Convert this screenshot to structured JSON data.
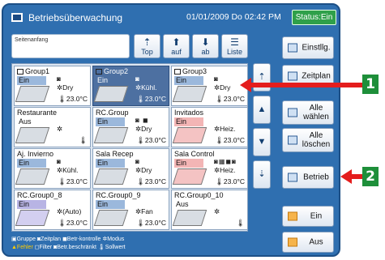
{
  "header": {
    "title": "Betriebsüberwachung",
    "datetime": "01/01/2009 Do 02:42 PM",
    "status": "Status:Ein"
  },
  "search": {
    "value": "Seitenanfang"
  },
  "nav": [
    {
      "symbol": "⇡",
      "label": "Top"
    },
    {
      "symbol": "⬆",
      "label": "auf"
    },
    {
      "symbol": "⬇",
      "label": "ab"
    },
    {
      "symbol": "☰",
      "label": "Liste"
    }
  ],
  "cells": [
    {
      "name": "Group1",
      "state": "Ein",
      "mode": "Dry",
      "temp": "23.0°C",
      "icons": "◙",
      "style": "on",
      "group_icon": true
    },
    {
      "name": "Group2",
      "state": "Ein",
      "mode": "Kühl.",
      "temp": "23.0°C",
      "icons": "◙",
      "style": "on",
      "group_icon": true,
      "selected": true
    },
    {
      "name": "Group3",
      "state": "Ein",
      "mode": "Dry",
      "temp": "23.0°C",
      "icons": "◙",
      "style": "on",
      "group_icon": true
    },
    {
      "name": "Restaurante",
      "state": "Aus",
      "mode": "",
      "temp": "",
      "icons": "",
      "style": "off"
    },
    {
      "name": "RC.Group",
      "state": "Ein",
      "mode": "Dry",
      "temp": "23.0°C",
      "icons": "◙  ◼",
      "style": "on"
    },
    {
      "name": "Invitados",
      "state": "Ein",
      "mode": "Heiz.",
      "temp": "23.0°C",
      "icons": "",
      "style": "heat"
    },
    {
      "name": "Aj. Invierno",
      "state": "Ein",
      "mode": "Kühl.",
      "temp": "23.0°C",
      "icons": "◙",
      "style": "on"
    },
    {
      "name": "Sala Recep",
      "state": "Ein",
      "mode": "Dry",
      "temp": "23.0°C",
      "icons": "◙",
      "style": "on"
    },
    {
      "name": "Sala Control",
      "state": "Ein",
      "mode": "Heiz.",
      "temp": "23.0°C",
      "icons": "◙▦◼◙",
      "style": "heat"
    },
    {
      "name": "RC.Group0_8",
      "state": "Ein",
      "mode": "(Auto)",
      "temp": "23.0°C",
      "icons": "",
      "style": "purple"
    },
    {
      "name": "RC.Group0_9",
      "state": "Ein",
      "mode": "Fan",
      "temp": "23.0°C",
      "icons": "",
      "style": "on"
    },
    {
      "name": "RC.Group0_10",
      "state": "Aus",
      "mode": "",
      "temp": "",
      "icons": "",
      "style": "off"
    }
  ],
  "legend": {
    "row1": "▣Gruppe ◙Zeitplan ◼Betr-kontrolle ✲Modus",
    "row2_a": "▲Fehler",
    "row2_b": " ◻Filter  ◙Betr.beschränkt  🌡Sollwert"
  },
  "side_buttons": [
    {
      "label": "Einstllg.",
      "icon": "settings"
    },
    {
      "label": "Zeitplan",
      "icon": "calendar"
    },
    {
      "label": "Alle wählen",
      "icon": "select-all"
    },
    {
      "label": "Alle löschen",
      "icon": "clear-all"
    },
    {
      "label": "Betrieb",
      "icon": "operation"
    },
    {
      "label": "Ein",
      "icon": "on",
      "color": "orange"
    },
    {
      "label": "Aus",
      "icon": "off",
      "color": "orange"
    }
  ],
  "callouts": [
    "1",
    "2"
  ]
}
